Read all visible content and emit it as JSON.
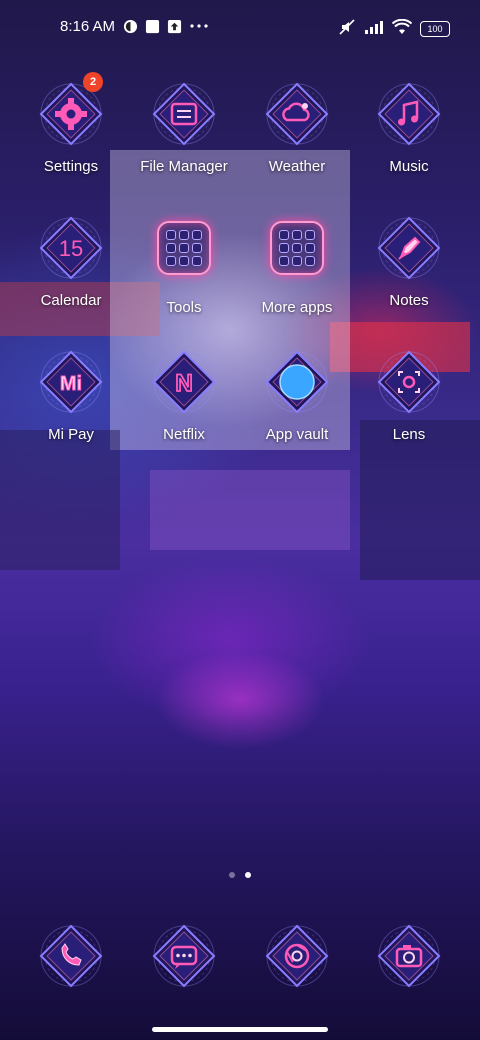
{
  "status_bar": {
    "time": "8:16 AM",
    "battery": "100"
  },
  "apps": [
    {
      "label": "Settings",
      "icon": "gear-icon",
      "badge": "2"
    },
    {
      "label": "File Manager",
      "icon": "folder-icon"
    },
    {
      "label": "Weather",
      "icon": "weather-icon"
    },
    {
      "label": "Music",
      "icon": "music-icon"
    },
    {
      "label": "Calendar",
      "icon": "calendar-icon",
      "icon_text": "15"
    },
    {
      "label": "Tools",
      "icon": "folder-group-icon"
    },
    {
      "label": "More apps",
      "icon": "folder-group-icon"
    },
    {
      "label": "Notes",
      "icon": "pen-icon"
    },
    {
      "label": "Mi Pay",
      "icon": "mi-pay-icon",
      "icon_text": "Mi"
    },
    {
      "label": "Netflix",
      "icon": "netflix-icon",
      "icon_text": "N"
    },
    {
      "label": "App vault",
      "icon": "app-vault-icon"
    },
    {
      "label": "Lens",
      "icon": "lens-icon"
    }
  ],
  "dock": [
    {
      "name": "phone",
      "icon": "phone-icon"
    },
    {
      "name": "messages",
      "icon": "message-icon"
    },
    {
      "name": "browser",
      "icon": "browser-icon"
    },
    {
      "name": "camera",
      "icon": "camera-icon"
    }
  ],
  "page_indicator": {
    "pages": 2,
    "current": 2
  },
  "colors": {
    "neon_pink": "#ff4aa8",
    "neon_blue": "#7a8cff",
    "badge": "#f0442a"
  }
}
